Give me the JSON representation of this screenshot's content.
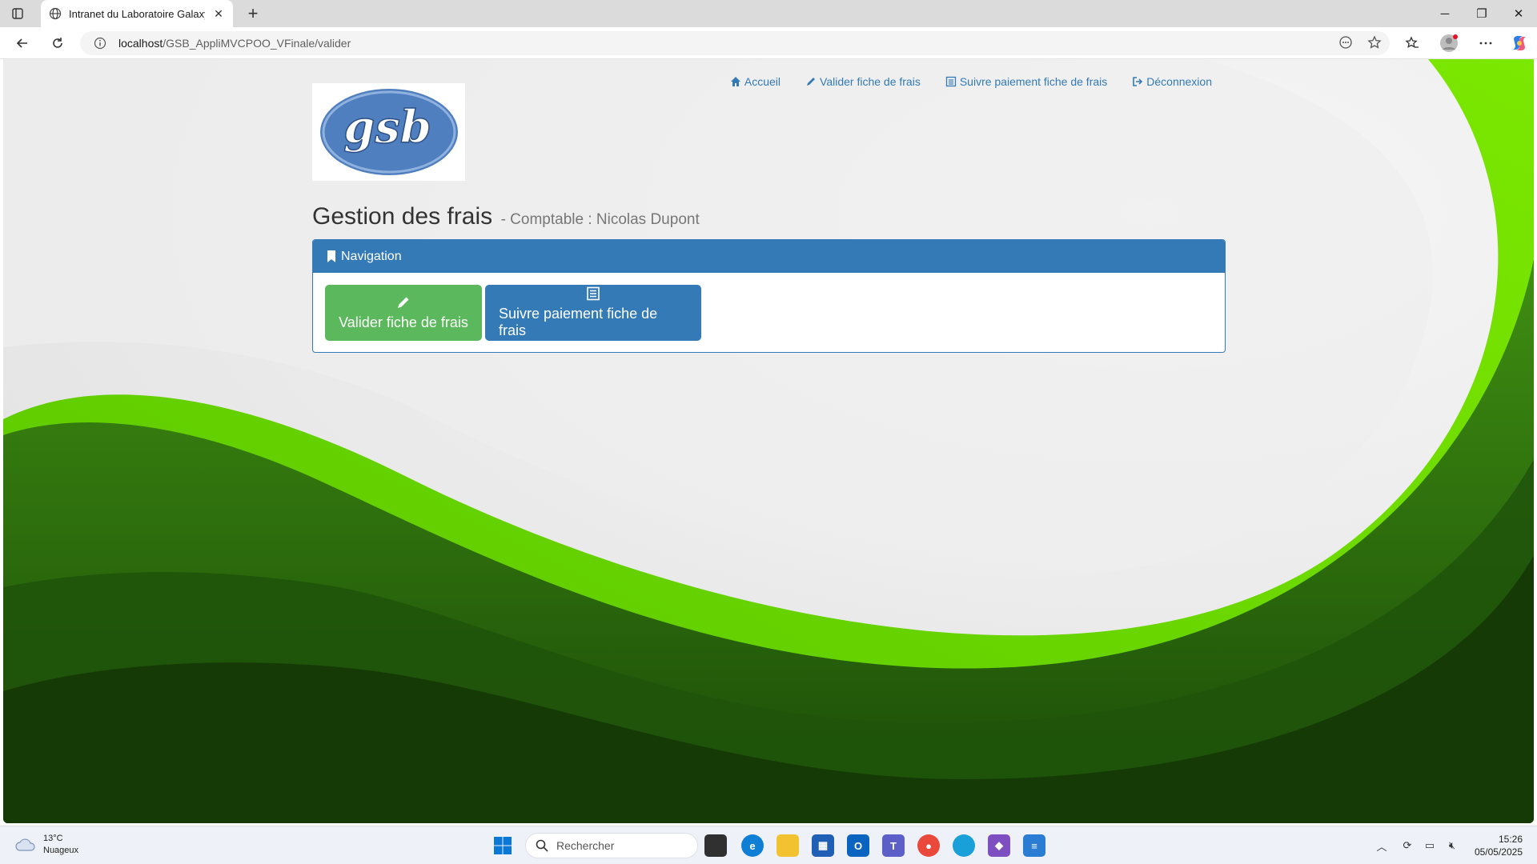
{
  "browser": {
    "tab_title": "Intranet du Laboratoire Galaxy-Swiss Bourdin",
    "new_tab_label": "+",
    "url_host": "localhost",
    "url_path": "/GSB_AppliMVCPOO_VFinale/valider"
  },
  "page": {
    "logo_text": "gsb",
    "top_nav": {
      "accueil": "Accueil",
      "valider": "Valider fiche de frais",
      "suivre": "Suivre paiement fiche de frais",
      "deconnexion": "Déconnexion"
    },
    "heading_main": "Gestion des frais",
    "heading_sub": "- Comptable : Nicolas Dupont",
    "panel": {
      "title": "Navigation",
      "btn_valider": "Valider fiche de frais",
      "btn_suivre": "Suivre paiement fiche de frais"
    }
  },
  "taskbar": {
    "temperature": "13°C",
    "weather": "Nuageux",
    "search_placeholder": "Rechercher",
    "time": "15:26",
    "date": "05/05/2025"
  },
  "colors": {
    "primary": "#337ab7",
    "success": "#5cb85c",
    "green_bright": "#6fdc00",
    "green_dark": "#1d4a0b"
  }
}
